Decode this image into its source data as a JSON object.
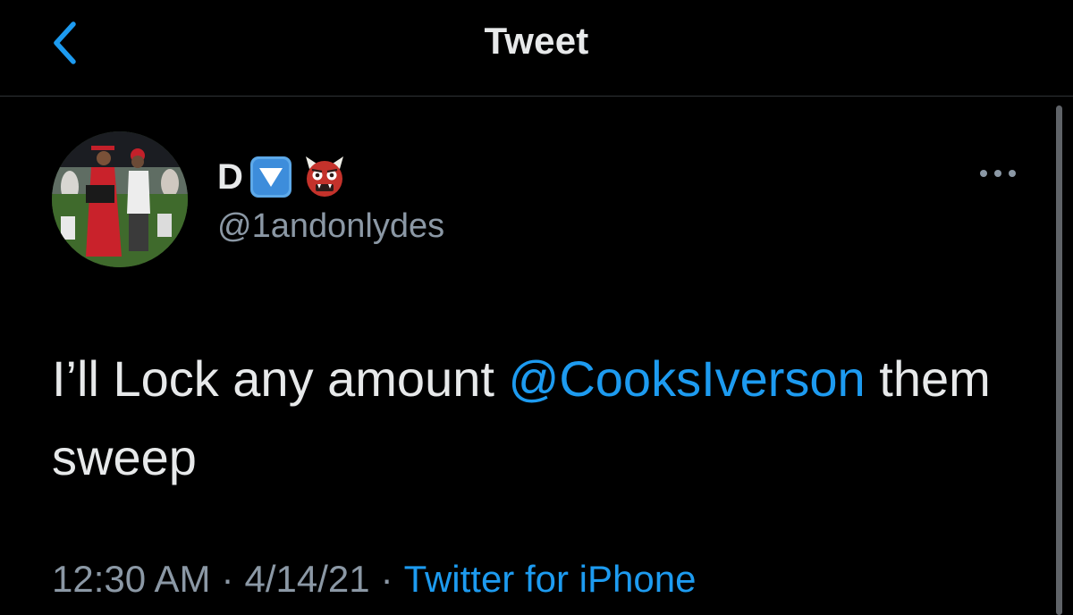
{
  "nav": {
    "title": "Tweet",
    "back_icon": "chevron-left-icon"
  },
  "tweet": {
    "author": {
      "display_name": "D",
      "name_emojis": [
        "down-arrow-button-emoji",
        "ogre-mask-emoji"
      ],
      "username": "@1andonlydes"
    },
    "text_before": "I’ll Lock any amount ",
    "mention": "@CooksIverson",
    "text_after": " them sweep",
    "timestamp": "12:30 AM",
    "date": "4/14/21",
    "separator": "·",
    "source": "Twitter for iPhone"
  },
  "colors": {
    "background": "#000000",
    "text_primary": "#e7e9ea",
    "text_secondary": "#8b98a5",
    "accent": "#1d9bf0",
    "divider": "#2f3336"
  }
}
